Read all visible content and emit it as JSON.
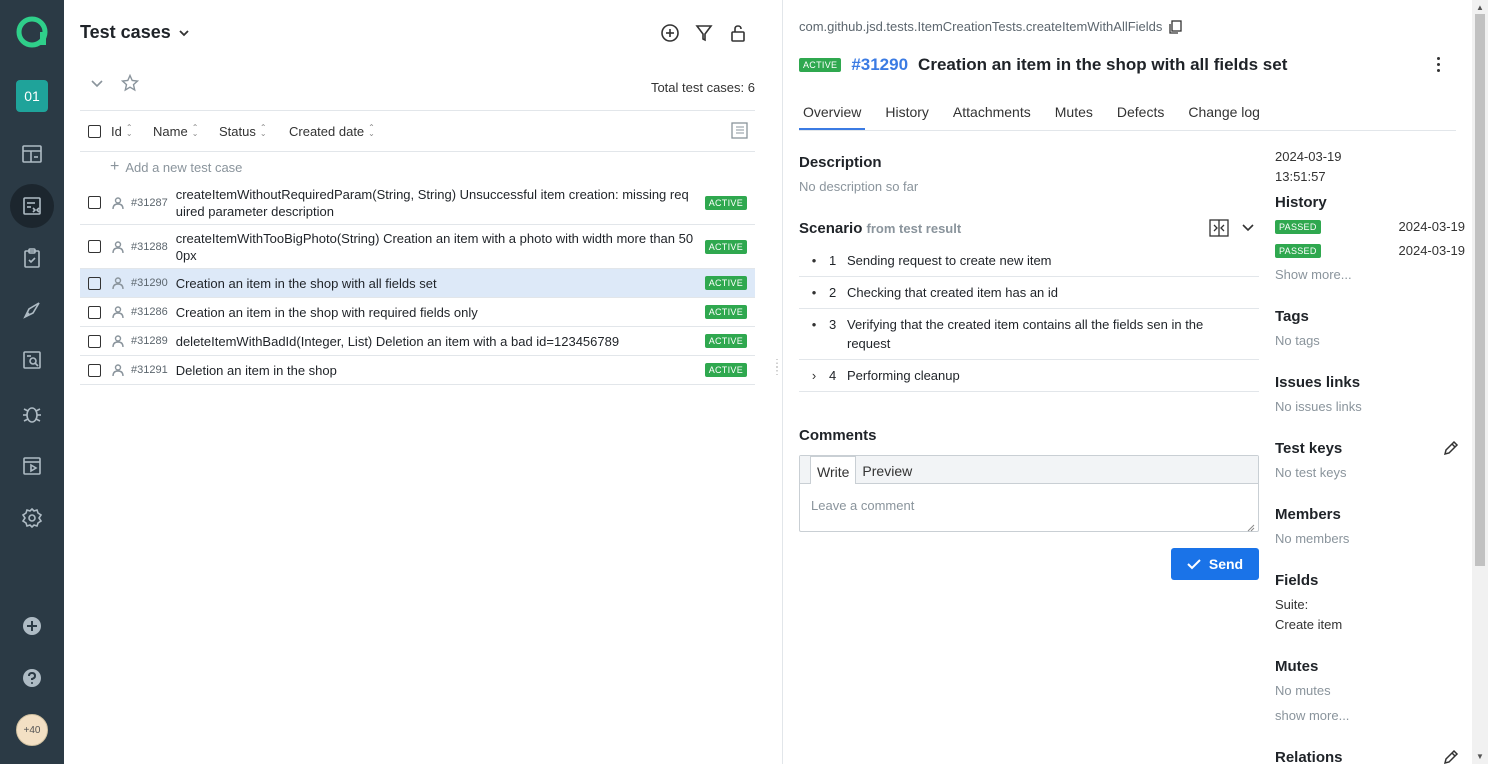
{
  "sidebar": {
    "project_badge": "01",
    "items": [
      {
        "icon": "dashboard-icon"
      },
      {
        "icon": "test-cases-icon",
        "active": true
      },
      {
        "icon": "test-plans-icon"
      },
      {
        "icon": "launches-icon"
      },
      {
        "icon": "analytics-icon"
      },
      {
        "icon": "defects-icon"
      },
      {
        "icon": "jobs-icon"
      },
      {
        "icon": "settings-icon"
      }
    ],
    "avatar_label": "+40"
  },
  "left_panel": {
    "title": "Test cases",
    "total_label": "Total test cases: 6",
    "columns": {
      "id": "Id",
      "name": "Name",
      "status": "Status",
      "created": "Created date"
    },
    "add_label": "Add a new test case",
    "rows": [
      {
        "id": "#31287",
        "name": "createItemWithoutRequiredParam(String, String) Unsuccessful item creation: missing required parameter description",
        "status": "ACTIVE"
      },
      {
        "id": "#31288",
        "name": "createItemWithTooBigPhoto(String) Creation an item with a photo with width more than 500px",
        "status": "ACTIVE"
      },
      {
        "id": "#31290",
        "name": "Creation an item in the shop with all fields set",
        "status": "ACTIVE",
        "selected": true
      },
      {
        "id": "#31286",
        "name": "Creation an item in the shop with required fields only",
        "status": "ACTIVE"
      },
      {
        "id": "#31289",
        "name": "deleteItemWithBadId(Integer, List) Deletion an item with a bad id=123456789",
        "status": "ACTIVE"
      },
      {
        "id": "#31291",
        "name": "Deletion an item in the shop",
        "status": "ACTIVE"
      }
    ]
  },
  "detail": {
    "path": "com.github.jsd.tests.ItemCreationTests.createItemWithAllFields",
    "status": "ACTIVE",
    "id": "#31290",
    "title": "Creation an item in the shop with all fields set",
    "tabs": [
      "Overview",
      "History",
      "Attachments",
      "Mutes",
      "Defects",
      "Change log"
    ],
    "description_heading": "Description",
    "description_text": "No description so far",
    "scenario_heading": "Scenario",
    "scenario_sub": "from test result",
    "steps": [
      {
        "num": "1",
        "text": "Sending request to create new item",
        "marker": "•"
      },
      {
        "num": "2",
        "text": "Checking that created item has an id",
        "marker": "•"
      },
      {
        "num": "3",
        "text": "Verifying that the created item contains all the fields sen in the request",
        "marker": "•"
      },
      {
        "num": "4",
        "text": "Performing cleanup",
        "marker": "›"
      }
    ],
    "comments_heading": "Comments",
    "comment_tabs": {
      "write": "Write",
      "preview": "Preview"
    },
    "comment_placeholder": "Leave a comment",
    "send_label": "Send"
  },
  "side": {
    "created_date": "2024-03-19",
    "created_time": "13:51:57",
    "history_heading": "History",
    "history": [
      {
        "status": "PASSED",
        "date": "2024-03-19"
      },
      {
        "status": "PASSED",
        "date": "2024-03-19"
      }
    ],
    "show_more": "Show more...",
    "tags_heading": "Tags",
    "tags_text": "No tags",
    "issues_heading": "Issues links",
    "issues_text": "No issues links",
    "keys_heading": "Test keys",
    "keys_text": "No test keys",
    "members_heading": "Members",
    "members_text": "No members",
    "fields_heading": "Fields",
    "suite_label": "Suite:",
    "suite_value": "Create item",
    "mutes_heading": "Mutes",
    "mutes_text": "No mutes",
    "mutes_more": "show more...",
    "relations_heading": "Relations"
  }
}
